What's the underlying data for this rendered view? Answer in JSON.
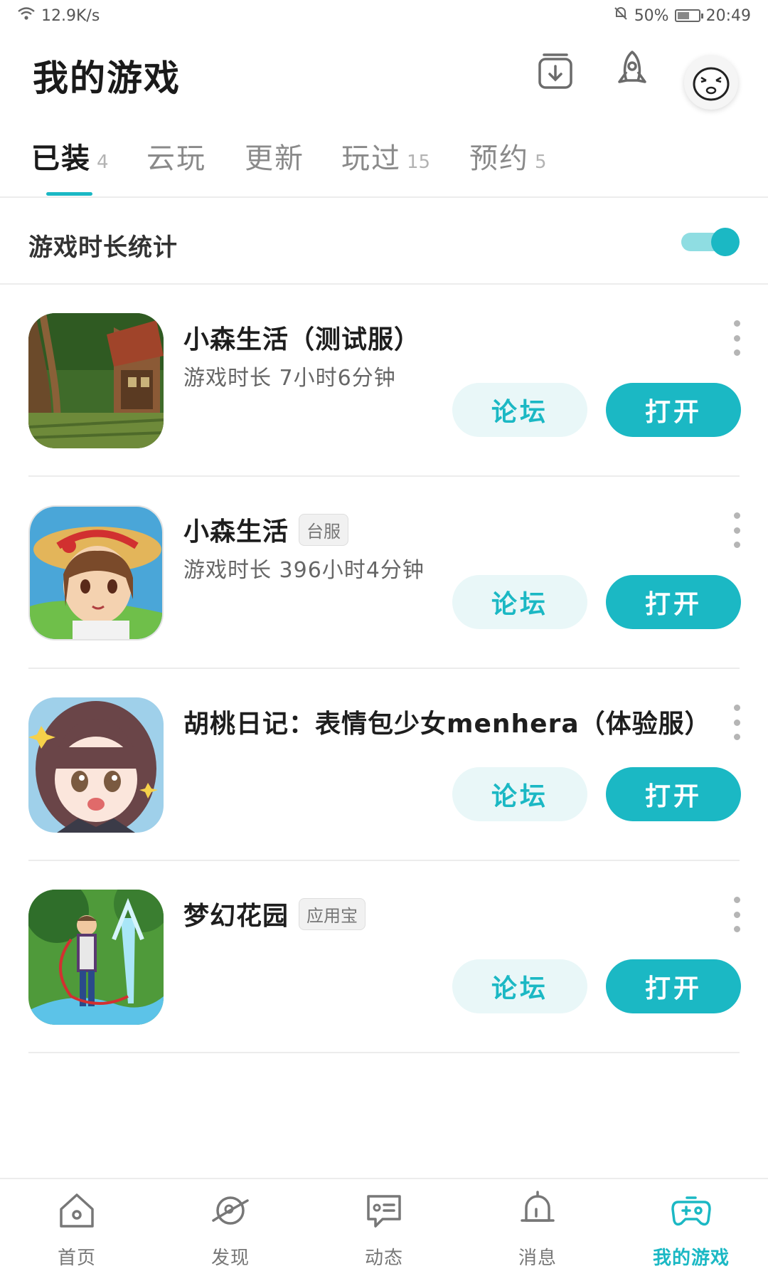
{
  "status_bar": {
    "network_speed": "12.9K/s",
    "battery": "50%",
    "time": "20:49"
  },
  "header": {
    "title": "我的游戏"
  },
  "tabs": [
    {
      "label": "已装",
      "count": "4",
      "active": true
    },
    {
      "label": "云玩",
      "count": ""
    },
    {
      "label": "更新",
      "count": ""
    },
    {
      "label": "玩过",
      "count": "15"
    },
    {
      "label": "预约",
      "count": "5"
    }
  ],
  "stats": {
    "label": "游戏时长统计",
    "toggle_on": true
  },
  "games": [
    {
      "name": "小森生活（测试服）",
      "tag": "",
      "playtime": "游戏时长 7小时6分钟",
      "forum_label": "论坛",
      "open_label": "打开",
      "icon": "forest-cabin-icon"
    },
    {
      "name": "小森生活",
      "tag": "台服",
      "playtime": "游戏时长 396小时4分钟",
      "forum_label": "论坛",
      "open_label": "打开",
      "icon": "straw-hat-girl-icon"
    },
    {
      "name": "胡桃日记：表情包少女menhera（体验服）",
      "tag": "",
      "playtime": "",
      "forum_label": "论坛",
      "open_label": "打开",
      "icon": "anime-girl-icon"
    },
    {
      "name": "梦幻花园",
      "tag": "应用宝",
      "playtime": "",
      "forum_label": "论坛",
      "open_label": "打开",
      "icon": "garden-butler-icon"
    }
  ],
  "bottom_nav": [
    {
      "label": "首页",
      "icon": "home-icon"
    },
    {
      "label": "发现",
      "icon": "planet-icon"
    },
    {
      "label": "动态",
      "icon": "chat-icon"
    },
    {
      "label": "消息",
      "icon": "bell-icon"
    },
    {
      "label": "我的游戏",
      "icon": "gamepad-icon",
      "active": true
    }
  ],
  "colors": {
    "accent": "#1bb8c4",
    "accent_light": "#e9f7f8"
  }
}
